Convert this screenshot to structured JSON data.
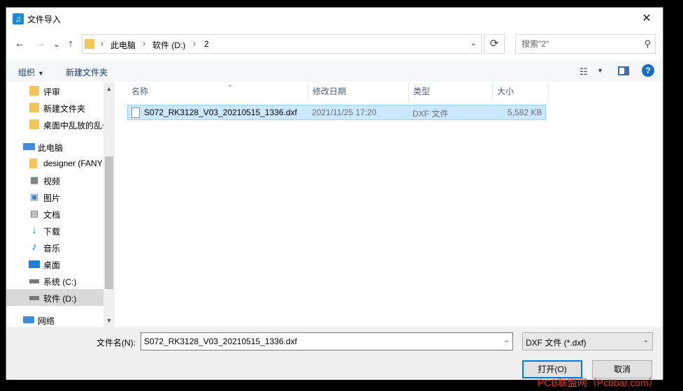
{
  "window": {
    "title": "文件导入",
    "close": "✕"
  },
  "nav": {
    "back": "←",
    "forward": "→",
    "recent": "⌄",
    "up": "↑",
    "breadcrumbs": [
      "此电脑",
      "软件 (D:)",
      "2"
    ],
    "refresh": "⟳",
    "search_placeholder": "搜索\"2\""
  },
  "toolbar": {
    "organize": "组织",
    "new_folder": "新建文件夹"
  },
  "sidebar": {
    "items": [
      {
        "label": "评审",
        "icon": "folder-icon"
      },
      {
        "label": "新建文件夹",
        "icon": "folder-icon"
      },
      {
        "label": "桌面中乱放的乱七",
        "icon": "folder-icon"
      },
      {
        "label": "此电脑",
        "icon": "pc-icon"
      },
      {
        "label": "designer (FANY",
        "icon": "user-folder-icon"
      },
      {
        "label": "视频",
        "icon": "video-icon"
      },
      {
        "label": "图片",
        "icon": "picture-icon"
      },
      {
        "label": "文档",
        "icon": "document-icon"
      },
      {
        "label": "下载",
        "icon": "download-icon"
      },
      {
        "label": "音乐",
        "icon": "music-icon"
      },
      {
        "label": "桌面",
        "icon": "desktop-icon"
      },
      {
        "label": "系统 (C:)",
        "icon": "drive-icon"
      },
      {
        "label": "软件 (D:)",
        "icon": "drive-icon"
      },
      {
        "label": "网络",
        "icon": "network-icon"
      }
    ]
  },
  "columns": [
    "名称",
    "修改日期",
    "类型",
    "大小"
  ],
  "files": [
    {
      "name": "S072_RK3128_V03_20210515_1336.dxf",
      "modified": "2021/11/25 17:20",
      "type": "DXF 文件",
      "size": "5,582 KB"
    }
  ],
  "footer": {
    "filename_label": "文件名(N):",
    "filename_value": "S072_RK3128_V03_20210515_1336.dxf",
    "filetype": "DXF 文件 (*.dxf)",
    "open": "打开(O)",
    "cancel": "取消"
  },
  "watermark": "PCB联盟网（Pcbbar.com）"
}
